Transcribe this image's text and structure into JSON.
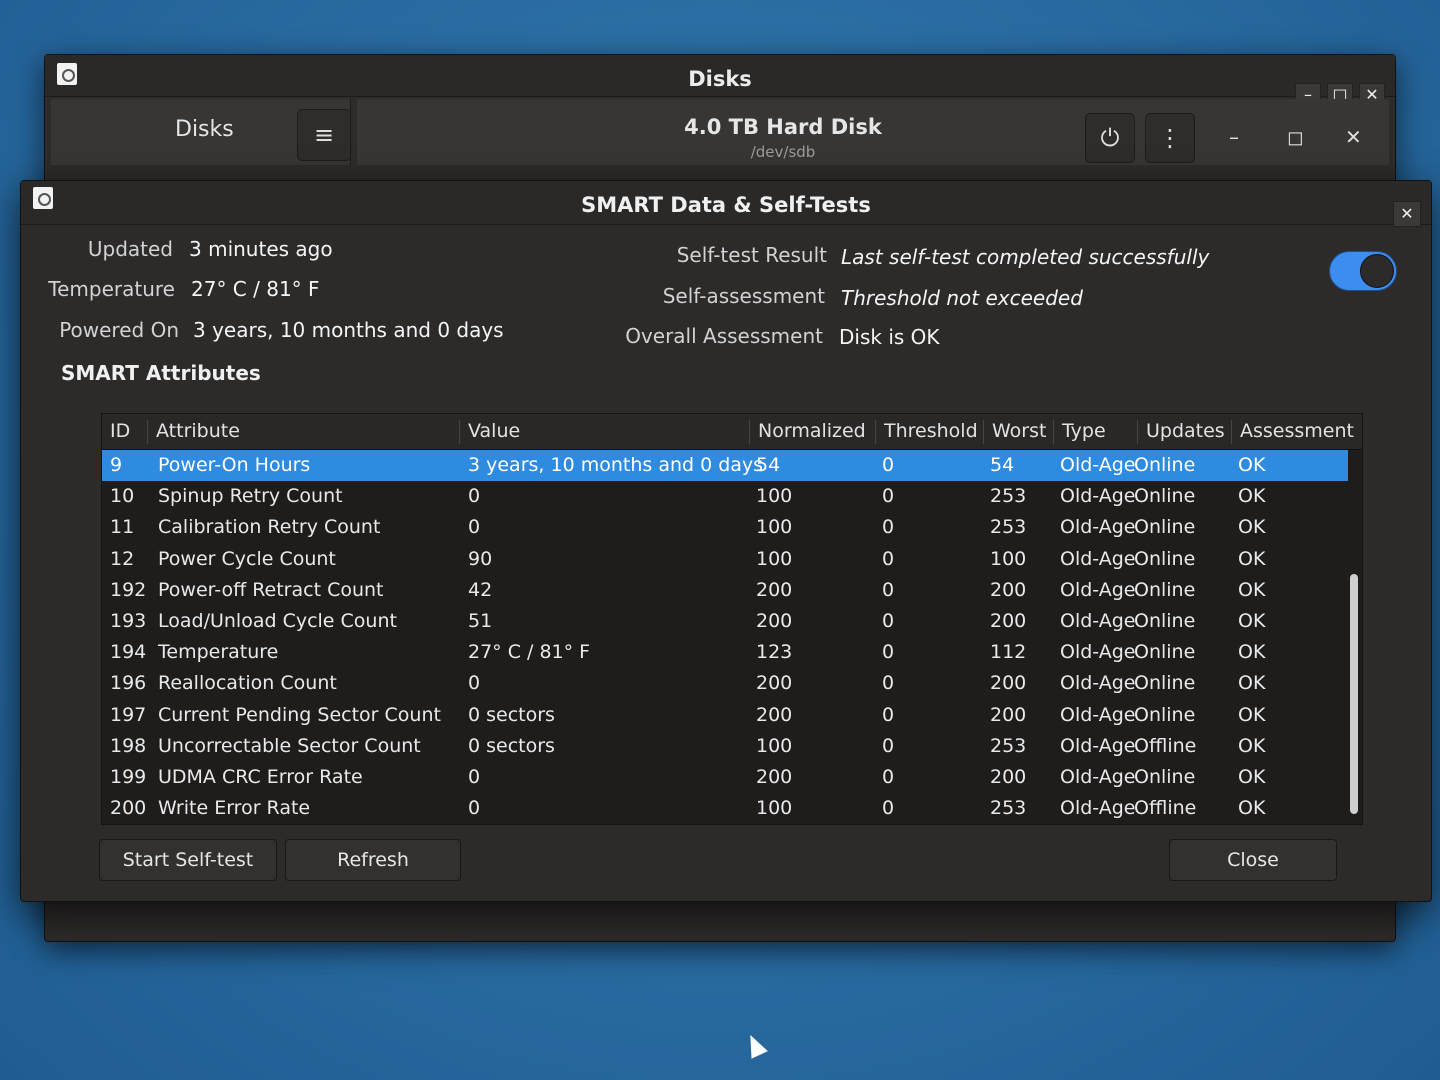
{
  "disks_window": {
    "title": "Disks",
    "sidebar_title": "Disks",
    "menu_icon": "hamburger-icon",
    "disk_title": "4.0 TB Hard Disk",
    "disk_device": "/dev/sdb",
    "power_icon": "power-icon",
    "more_icon": "vertical-dots-icon"
  },
  "dialog": {
    "title": "SMART Data & Self-Tests",
    "updated_label": "Updated",
    "updated_value": "3 minutes ago",
    "temperature_label": "Temperature",
    "temperature_value": "27° C / 81° F",
    "powered_on_label": "Powered On",
    "powered_on_value": "3 years, 10 months and 0 days",
    "self_test_label": "Self-test Result",
    "self_test_value": "Last self-test completed successfully",
    "self_assessment_label": "Self-assessment",
    "self_assessment_value": "Threshold not exceeded",
    "overall_label": "Overall Assessment",
    "overall_value": "Disk is OK",
    "smart_enabled": true,
    "section_title": "SMART Attributes",
    "columns": [
      "ID",
      "Attribute",
      "Value",
      "Normalized",
      "Threshold",
      "Worst",
      "Type",
      "Updates",
      "Assessment"
    ],
    "rows": [
      {
        "id": "9",
        "attribute": "Power-On Hours",
        "value": "3 years, 10 months and 0 days",
        "normalized": "54",
        "threshold": "0",
        "worst": "54",
        "type": "Old-Age",
        "updates": "Online",
        "assessment": "OK"
      },
      {
        "id": "10",
        "attribute": "Spinup Retry Count",
        "value": "0",
        "normalized": "100",
        "threshold": "0",
        "worst": "253",
        "type": "Old-Age",
        "updates": "Online",
        "assessment": "OK"
      },
      {
        "id": "11",
        "attribute": "Calibration Retry Count",
        "value": "0",
        "normalized": "100",
        "threshold": "0",
        "worst": "253",
        "type": "Old-Age",
        "updates": "Online",
        "assessment": "OK"
      },
      {
        "id": "12",
        "attribute": "Power Cycle Count",
        "value": "90",
        "normalized": "100",
        "threshold": "0",
        "worst": "100",
        "type": "Old-Age",
        "updates": "Online",
        "assessment": "OK"
      },
      {
        "id": "192",
        "attribute": "Power-off Retract Count",
        "value": "42",
        "normalized": "200",
        "threshold": "0",
        "worst": "200",
        "type": "Old-Age",
        "updates": "Online",
        "assessment": "OK"
      },
      {
        "id": "193",
        "attribute": "Load/Unload Cycle Count",
        "value": "51",
        "normalized": "200",
        "threshold": "0",
        "worst": "200",
        "type": "Old-Age",
        "updates": "Online",
        "assessment": "OK"
      },
      {
        "id": "194",
        "attribute": "Temperature",
        "value": "27° C / 81° F",
        "normalized": "123",
        "threshold": "0",
        "worst": "112",
        "type": "Old-Age",
        "updates": "Online",
        "assessment": "OK"
      },
      {
        "id": "196",
        "attribute": "Reallocation Count",
        "value": "0",
        "normalized": "200",
        "threshold": "0",
        "worst": "200",
        "type": "Old-Age",
        "updates": "Online",
        "assessment": "OK"
      },
      {
        "id": "197",
        "attribute": "Current Pending Sector Count",
        "value": "0 sectors",
        "normalized": "200",
        "threshold": "0",
        "worst": "200",
        "type": "Old-Age",
        "updates": "Online",
        "assessment": "OK"
      },
      {
        "id": "198",
        "attribute": "Uncorrectable Sector Count",
        "value": "0 sectors",
        "normalized": "100",
        "threshold": "0",
        "worst": "253",
        "type": "Old-Age",
        "updates": "Offline",
        "assessment": "OK"
      },
      {
        "id": "199",
        "attribute": "UDMA CRC Error Rate",
        "value": "0",
        "normalized": "200",
        "threshold": "0",
        "worst": "200",
        "type": "Old-Age",
        "updates": "Online",
        "assessment": "OK"
      },
      {
        "id": "200",
        "attribute": "Write Error Rate",
        "value": "0",
        "normalized": "100",
        "threshold": "0",
        "worst": "253",
        "type": "Old-Age",
        "updates": "Offline",
        "assessment": "OK"
      }
    ],
    "start_self_test_label": "Start Self-test",
    "refresh_label": "Refresh",
    "close_label": "Close",
    "accent_color": "#2f8be0"
  }
}
